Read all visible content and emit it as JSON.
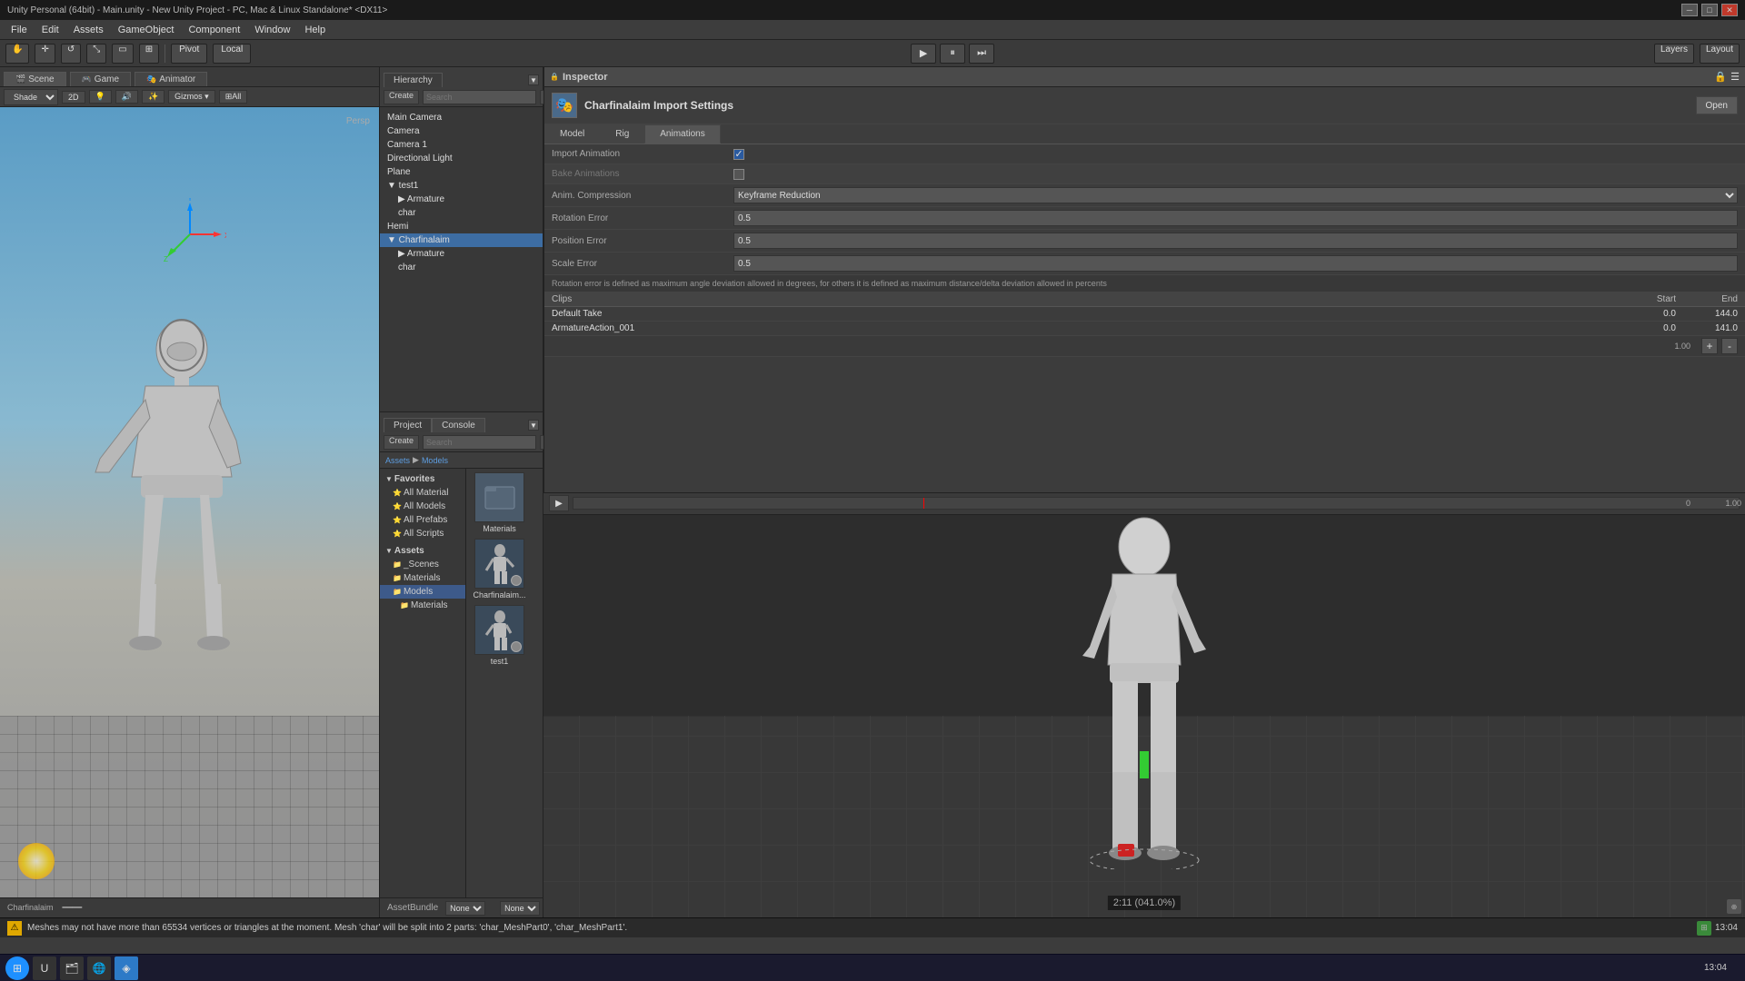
{
  "titlebar": {
    "title": "Unity Personal (64bit) - Main.unity - New Unity Project - PC, Mac & Linux Standalone* <DX11>",
    "controls": [
      "minimize",
      "maximize",
      "close"
    ]
  },
  "menubar": {
    "items": [
      "File",
      "Edit",
      "Assets",
      "GameObject",
      "Component",
      "Window",
      "Help"
    ]
  },
  "toolbar": {
    "transform_tools": [
      "hand",
      "move",
      "rotate",
      "scale",
      "rect",
      "transform"
    ],
    "pivot_label": "Pivot",
    "local_label": "Local",
    "play_label": "▶",
    "pause_label": "⏸",
    "step_label": "⏭",
    "layers_label": "Layers",
    "layout_label": "Layout"
  },
  "scene_view": {
    "tabs": [
      "Scene",
      "Game",
      "Animator"
    ],
    "active_tab": "Scene",
    "shading": "Shaded",
    "view_mode": "2D",
    "gizmos": "Gizmos",
    "all_label": "All",
    "persp_label": "Persp"
  },
  "hierarchy": {
    "tab_label": "Hierarchy",
    "search_placeholder": "Search",
    "all_label": "All",
    "create_label": "Create",
    "items": [
      {
        "label": "Main Camera",
        "indent": 0,
        "arrow": ""
      },
      {
        "label": "Camera",
        "indent": 0,
        "arrow": ""
      },
      {
        "label": "Camera 1",
        "indent": 0,
        "arrow": ""
      },
      {
        "label": "Directional Light",
        "indent": 0,
        "arrow": ""
      },
      {
        "label": "Plane",
        "indent": 0,
        "arrow": ""
      },
      {
        "label": "test1",
        "indent": 0,
        "arrow": "▼"
      },
      {
        "label": "Armature",
        "indent": 1,
        "arrow": "▶"
      },
      {
        "label": "char",
        "indent": 1,
        "arrow": ""
      },
      {
        "label": "Hemi",
        "indent": 0,
        "arrow": ""
      },
      {
        "label": "Charfinalaim",
        "indent": 0,
        "arrow": "▼",
        "selected": true
      },
      {
        "label": "Armature",
        "indent": 1,
        "arrow": "▶"
      },
      {
        "label": "char",
        "indent": 1,
        "arrow": ""
      }
    ]
  },
  "project": {
    "tabs": [
      "Project",
      "Console"
    ],
    "active_tab": "Project",
    "create_label": "Create",
    "search_placeholder": "Search",
    "favorites": {
      "label": "Favorites",
      "items": [
        "All Material",
        "All Models",
        "All Prefabs",
        "All Scripts"
      ]
    },
    "assets": {
      "label": "Assets",
      "items": [
        {
          "label": "_Scenes",
          "type": "folder",
          "indent": 1
        },
        {
          "label": "Materials",
          "type": "folder",
          "indent": 1
        },
        {
          "label": "Models",
          "type": "folder",
          "indent": 1,
          "selected": true
        },
        {
          "label": "Materials",
          "type": "folder",
          "indent": 2
        }
      ]
    },
    "breadcrumb": "Assets > Models",
    "asset_items": [
      {
        "label": "Materials",
        "type": "folder"
      },
      {
        "label": "Charfinalaim...",
        "type": "model",
        "selected": true
      },
      {
        "label": "test1",
        "type": "model"
      }
    ]
  },
  "inspector": {
    "tab_label": "Inspector",
    "title": "Charfinalaim Import Settings",
    "icon": "model-icon",
    "open_label": "Open",
    "tabs": [
      "Model",
      "Rig",
      "Animations"
    ],
    "active_tab": "Animations",
    "settings": {
      "import_animation_label": "Import Animation",
      "import_animation_checked": true,
      "bake_animations_label": "Bake Animations",
      "bake_animations_checked": false,
      "anim_compression_label": "Anim. Compression",
      "anim_compression_value": "Keyframe Reduction",
      "rotation_error_label": "Rotation Error",
      "rotation_error_value": "0.5",
      "position_error_label": "Position Error",
      "position_error_value": "0.5",
      "scale_error_label": "Scale Error",
      "scale_error_value": "0.5",
      "rotation_note": "Rotation error is defined as maximum angle deviation allowed in degrees, for others it is defined as maximum distance/delta deviation allowed in percents"
    },
    "clips": {
      "label": "Clips",
      "start_label": "Start",
      "end_label": "End",
      "items": [
        {
          "name": "Default Take",
          "start": "0.0",
          "end": "144.0",
          "selected": false
        },
        {
          "name": "ArmatureAction_001",
          "start": "0.0",
          "end": "141.0",
          "selected": false
        }
      ],
      "add_label": "+",
      "remove_label": "-"
    },
    "frame_count": "1.00"
  },
  "animation_preview": {
    "play_label": "▶",
    "time_display": "2:11 (041.0%)",
    "frame_label": "0",
    "end_frame": "1.00"
  },
  "statusbar": {
    "message": "Meshes may not have more than 65534 vertices or triangles at the moment. Mesh 'char' will be split into 2 parts: 'char_MeshPart0', 'char_MeshPart1'.",
    "right_label": "13:04"
  },
  "asset_bundle": {
    "label": "AssetBundle",
    "value": "None",
    "right_label": "None"
  },
  "taskbar": {
    "time": "13:04"
  }
}
